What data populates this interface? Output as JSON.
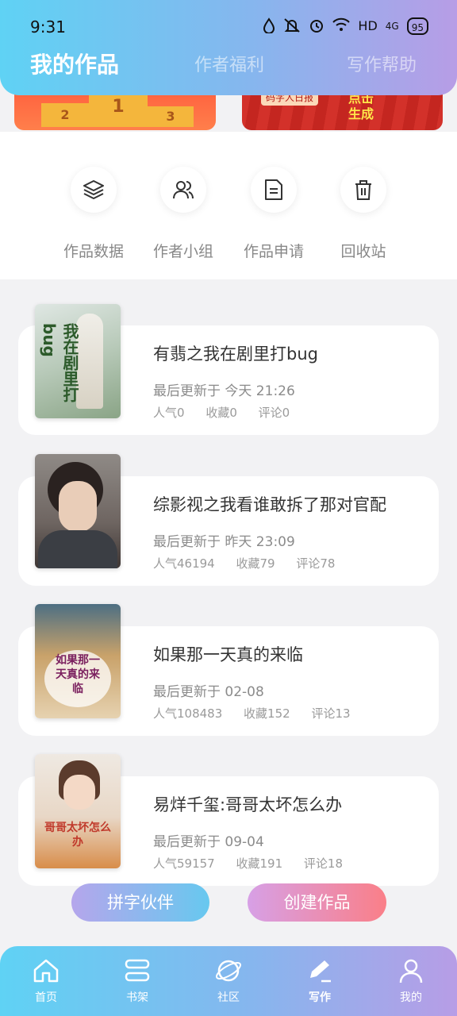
{
  "status_bar": {
    "time": "9:31",
    "network": "HD",
    "signal": "4G",
    "battery": "95"
  },
  "tabs": [
    {
      "label": "我的作品",
      "active": true
    },
    {
      "label": "作者福利",
      "active": false
    },
    {
      "label": "写作帮助",
      "active": false
    }
  ],
  "banners": {
    "left": {
      "podium": [
        "2",
        "1",
        "3"
      ]
    },
    "right": {
      "chip": "码字人日报",
      "cta_line1": "点击",
      "cta_line2": "生成"
    }
  },
  "quick_actions": [
    {
      "label": "作品数据",
      "icon": "layers-icon"
    },
    {
      "label": "作者小组",
      "icon": "users-icon"
    },
    {
      "label": "作品申请",
      "icon": "document-icon"
    },
    {
      "label": "回收站",
      "icon": "trash-icon"
    }
  ],
  "works": [
    {
      "title": "有翡之我在剧里打bug",
      "updated": "最后更新于 今天 21:26",
      "popularity": "人气0",
      "favorites": "收藏0",
      "comments": "评论0",
      "cover_text": "我在剧里打bug"
    },
    {
      "title": "综影视之我看谁敢拆了那对官配",
      "updated": "最后更新于 昨天 23:09",
      "popularity": "人气46194",
      "favorites": "收藏79",
      "comments": "评论78",
      "cover_text": ""
    },
    {
      "title": "如果那一天真的来临",
      "updated": "最后更新于 02-08",
      "popularity": "人气108483",
      "favorites": "收藏152",
      "comments": "评论13",
      "cover_text": "如果那一天真的来临"
    },
    {
      "title": "易烊千玺:哥哥太坏怎么办",
      "updated": "最后更新于 09-04",
      "popularity": "人气59157",
      "favorites": "收藏191",
      "comments": "评论18",
      "cover_text": "哥哥太坏怎么办"
    }
  ],
  "fab": {
    "partner": "拼字伙伴",
    "create": "创建作品"
  },
  "bottom_nav": [
    {
      "label": "首页",
      "icon": "home-icon"
    },
    {
      "label": "书架",
      "icon": "bookshelf-icon"
    },
    {
      "label": "社区",
      "icon": "planet-icon"
    },
    {
      "label": "写作",
      "icon": "pen-icon",
      "active": true
    },
    {
      "label": "我的",
      "icon": "user-icon"
    }
  ],
  "colors": {
    "gradient_start": "#5fd2f4",
    "gradient_end": "#b79de6",
    "text_muted": "#8b8b8b"
  }
}
